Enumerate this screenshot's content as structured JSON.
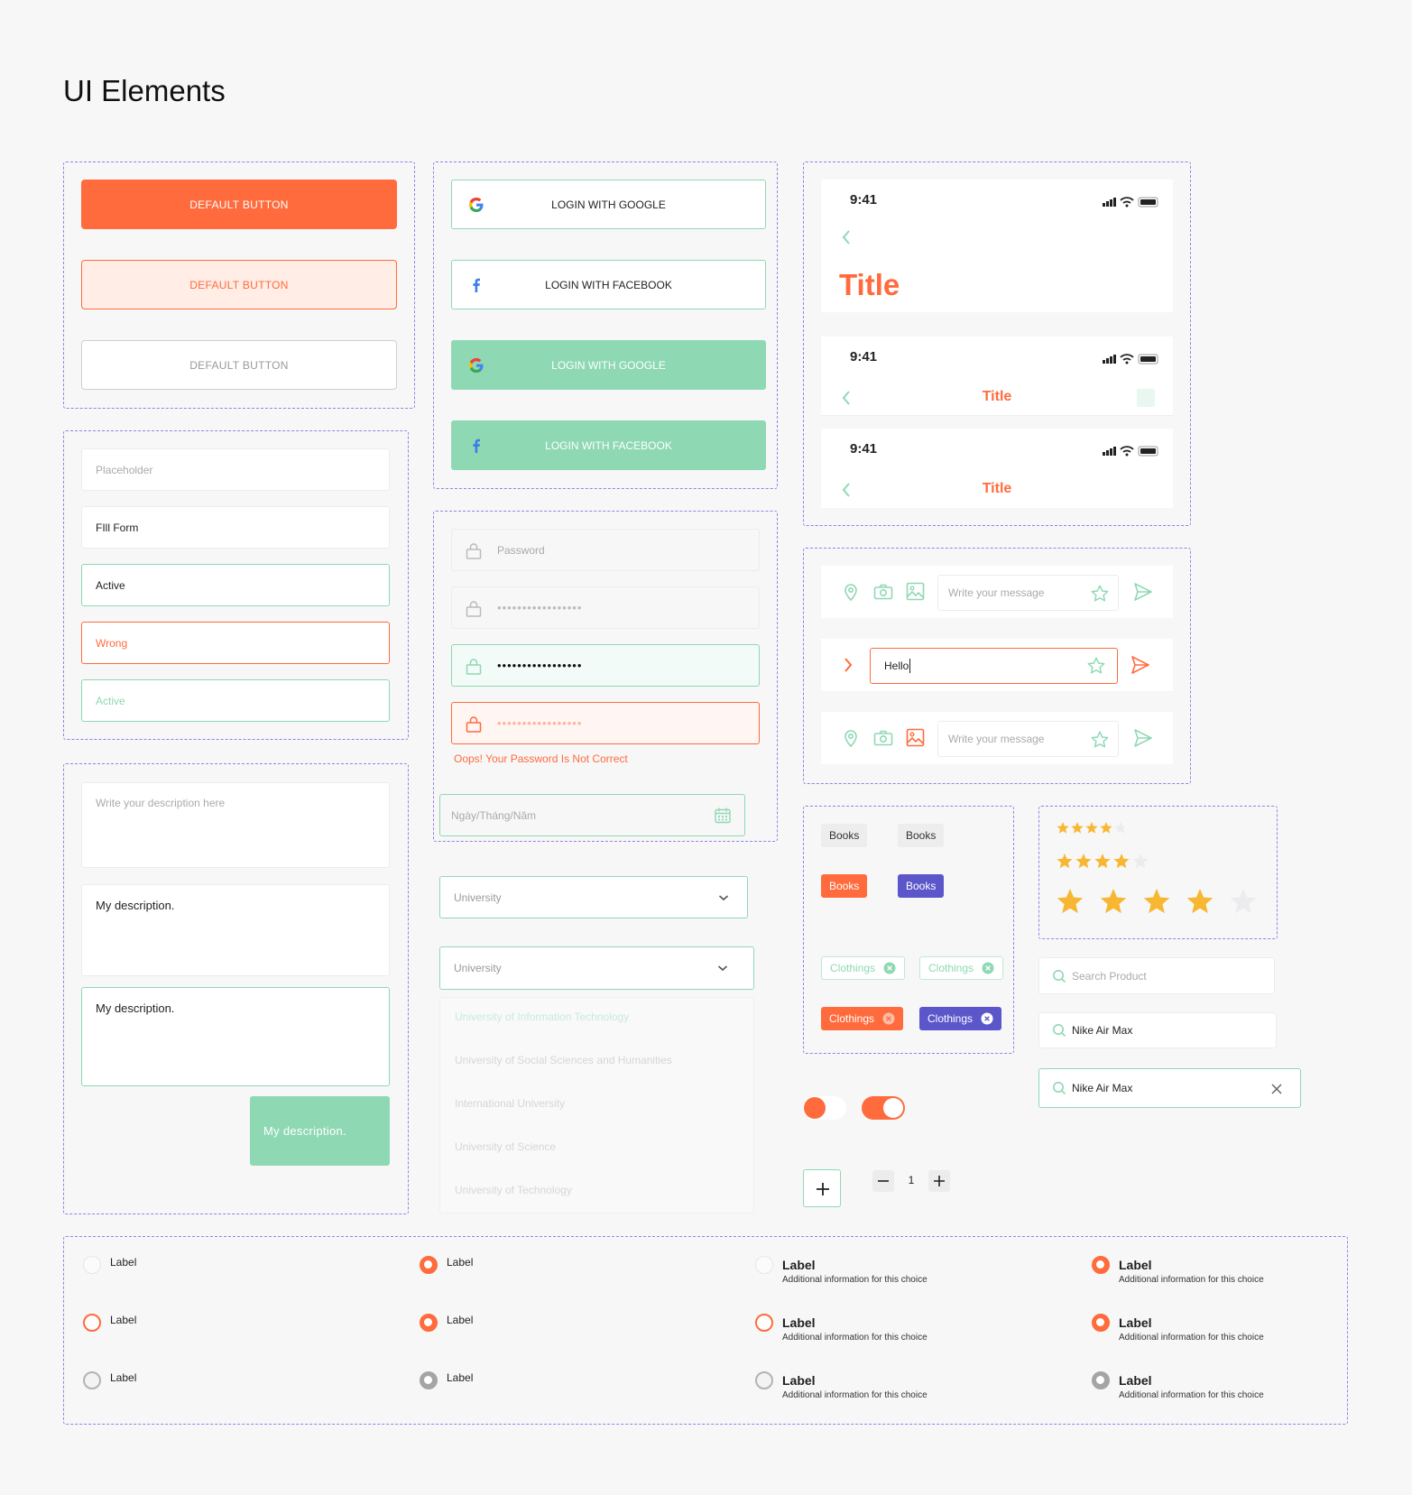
{
  "page": {
    "title": "UI Elements"
  },
  "buttons": {
    "primary": "DEFAULT BUTTON",
    "soft": "DEFAULT BUTTON",
    "outline": "DEFAULT BUTTON"
  },
  "social": {
    "google": "LOGIN WITH GOOGLE",
    "facebook": "LOGIN WITH FACEBOOK",
    "google_green": "LOGIN WITH GOOGLE",
    "facebook_green": "LOGIN WITH FACEBOOK"
  },
  "inputs": {
    "placeholder": "Placeholder",
    "filled": "FIll Form",
    "active": "Active",
    "wrong": "Wrong",
    "active_light": "Active"
  },
  "textareas": {
    "placeholder": "Write your description here",
    "filled": "My description.",
    "active": "My description.",
    "submit": "My description."
  },
  "password": {
    "placeholder": "Password",
    "masked": "•••••••••••••••••",
    "error": "Oops! Your Password Is Not Correct"
  },
  "date": {
    "placeholder": "Ngày/Tháng/Năm"
  },
  "phones": [
    {
      "time": "9:41",
      "title": "Title"
    },
    {
      "time": "9:41",
      "title": "Title"
    },
    {
      "time": "9:41",
      "title": "Title"
    }
  ],
  "messages": {
    "placeholder": "Write your message",
    "typed": "Hello",
    "placeholder2": "Write your message"
  },
  "dropdown": {
    "label1": "University",
    "label2": "University",
    "options": [
      "University of Information Technology",
      "University of Social Sciences and Humanities",
      "International University",
      "University of Science",
      "University of Technology"
    ]
  },
  "chips": {
    "books": [
      "Books",
      "Books",
      "Books",
      "Books"
    ],
    "clothings": [
      "Clothings",
      "Clothings",
      "Clothings",
      "Clothings"
    ]
  },
  "ratings": [
    4,
    4,
    4
  ],
  "search": {
    "placeholder": "Search Product",
    "value1": "Nike Air Max",
    "value2": "Nike Air Max"
  },
  "stepper": {
    "value": "1"
  },
  "radios": {
    "label": "Label",
    "rows": [
      "Label",
      "Label",
      "Label"
    ],
    "detailed_label": "Label",
    "detail": "Additional information for this choice"
  },
  "colors": {
    "orange": "#ff6b3d",
    "green": "#8fd8b4",
    "purple": "#5b56c9",
    "dash": "#8c86e6",
    "star": "#f7b733"
  }
}
